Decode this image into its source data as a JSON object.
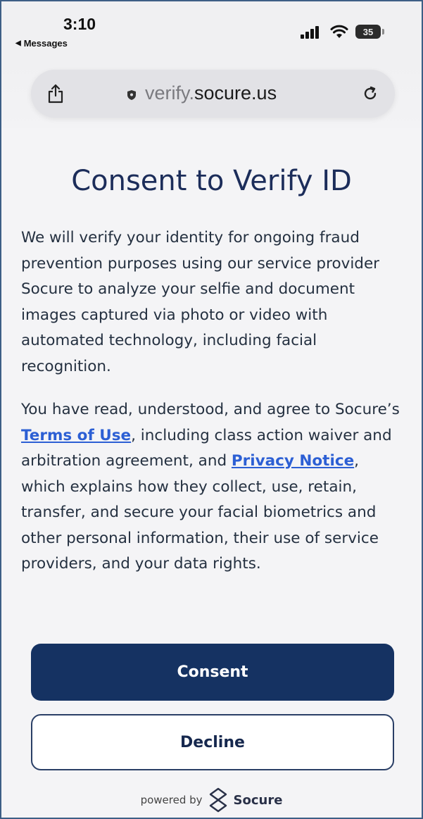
{
  "status_bar": {
    "time": "3:10",
    "back_app": "Messages",
    "battery_level": "35"
  },
  "browser": {
    "url_prefix": "verify.",
    "url_domain": "socure.us"
  },
  "page": {
    "title": "Consent to Verify ID",
    "paragraph1": "We will verify your identity for ongoing fraud prevention purposes using our service provider Socure to analyze your selfie and document images captured via photo or video with automated technology, including facial recognition.",
    "paragraph2_part1": "You have read, understood, and agree to Socure’s ",
    "terms_link": "Terms of Use",
    "paragraph2_part2": ", including class action waiver and arbitration agreement, and ",
    "privacy_link": "Privacy Notice",
    "paragraph2_part3": ", which explains how they collect, use, retain, transfer, and secure your facial biometrics and other personal information, their use of service providers, and your data rights.",
    "consent_label": "Consent",
    "decline_label": "Decline",
    "powered_by": "powered by",
    "brand": "Socure"
  },
  "colors": {
    "title": "#1c2d5a",
    "primary_button": "#153262",
    "link": "#2c5fd4",
    "body_text": "#243040"
  },
  "icons": [
    "share-icon",
    "lock-icon",
    "reload-icon",
    "signal-icon",
    "wifi-icon",
    "battery-icon",
    "socure-logo-icon"
  ]
}
